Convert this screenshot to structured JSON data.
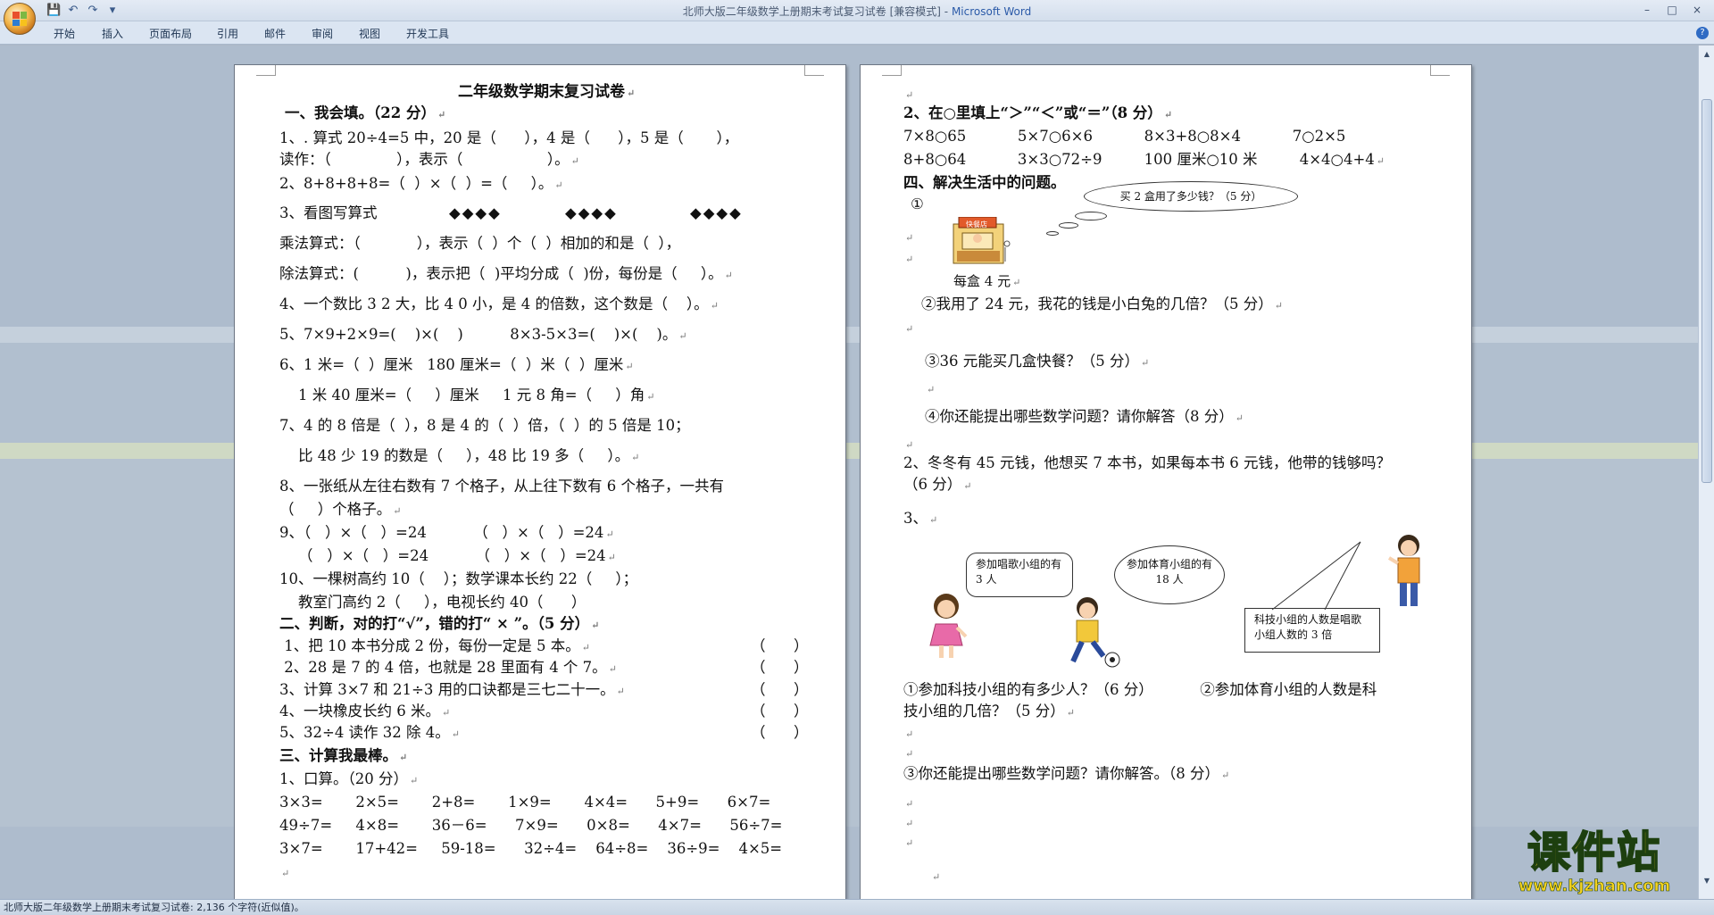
{
  "window": {
    "title_doc": "北师大版二年级数学上册期末考试复习试卷 [兼容模式]",
    "title_sep": " - ",
    "title_app": "Microsoft Word",
    "controls": [
      "–",
      "□",
      "×"
    ]
  },
  "quick_access": {
    "save": "💾",
    "undo": "↶",
    "redo": "↷",
    "more": "▾"
  },
  "ribbon": {
    "tabs": [
      "开始",
      "插入",
      "页面布局",
      "引用",
      "邮件",
      "审阅",
      "视图",
      "开发工具"
    ],
    "help": "?"
  },
  "status_bar": {
    "text": "北师大版二年级数学上册期末考试复习试卷: 2,136 个字符(近似值)。"
  },
  "watermark": {
    "brand": "课件站",
    "url": "www.kjzhan.com"
  },
  "page1": {
    "lines": [
      "二年级数学期末复习试卷",
      "一、我会填。（22 分）",
      "1、. 算式 20÷4=5 中，20 是（      ），4 是（      ），5 是（       ），",
      "读作：（              ），表示（                  ）。",
      "2、8+8+8+8=（  ）×（  ）=（     ）。",
      "3、看图写算式",
      "乘法算式：（            ），表示（  ）个（  ）相加的和是（  ），",
      "除法算式：(          )，表示把（  )平均分成（  )份，每份是（     ）。",
      "4、一个数比 3 2 大，比 4 0 小，是 4 的倍数，这个数是（    ）。",
      "5、7×9+2×9=(    )×(    )          8×3-5×3=(    )×(    )。",
      "6、1 米=（  ）厘米   180 厘米=（  ）米（  ）厘米",
      "    1 米 40 厘米=（     ）厘米     1 元 8 角=（     ）角",
      "7、4 的 8 倍是（  ），8 是 4 的（  ）倍，（  ）的 5 倍是 10；",
      "    比 48 少 19 的数是（     ），48 比 19 多（     ）。",
      "8、一张纸从左往右数有 7 个格子，从上往下数有 6 个格子，一共有",
      "（     ）个格子。",
      "9、（   ）×（   ）=24          （   ）×（   ）=24",
      "    （   ）×（   ）=24          （   ）×（   ）=24",
      "10、一棵树高约 10（    ）；数学课本长约 22（     ）；",
      "    教室门高约 2（     ），电视长约 40（      ）",
      "二、判断，对的打“√”，错的打“ × ”。（5 分）",
      " 1、把 10 本书分成 2 份，每份一定是 5 本。",
      " 2、28 是 7 的 4 倍，也就是 28 里面有 4 个 7。",
      "3、计算 3×7 和 21÷3 用的口诀都是三七二十一。",
      "4、一块橡皮长约 6 米。",
      "5、32÷4 读作 32 除 4。",
      "三、计算我最棒。",
      "1、口算。（20 分）",
      "3×3=       2×5=       2+8=       1×9=       4×4=      5+9=      6×7=",
      "49÷7=     4×8=       36－6=      7×9=      0×8=      4×7=      56÷7=",
      "3×7=       17+42=     59-18=      32÷4=    64÷8=    36÷9=    4×5="
    ],
    "diamonds": [
      "◆◆◆◆",
      "◆◆◆◆",
      "◆◆◆◆"
    ],
    "judge_brackets": [
      "（      ）",
      "（      ）",
      "（      ）",
      "（      ）",
      "（      ）"
    ]
  },
  "page2": {
    "lines": [
      "2、在○里填上“＞”“＜”或“＝”（8 分）",
      "7×8○65           5×7○6×6           8×3+8○8×4           7○2×5",
      "8+8○64           3×3○72÷9         100 厘米○10 米         4×4○4+4",
      "四、解决生活中的问题。",
      "①",
      "②我用了 24 元，我花的钱是小白兔的几倍？（5 分）",
      "③36 元能买几盒快餐？（5 分）",
      "④你还能提出哪些数学问题？请你解答（8 分）",
      "2、冬冬有 45 元钱，他想买 7 本书，如果每本书 6 元钱，他带的钱够吗？",
      "（6 分）",
      "3、",
      "①参加科技小组的有多少人？（6 分）          ②参加体育小组的人数是科",
      "技小组的几倍？（5 分）",
      "③你还能提出哪些数学问题？请你解答。（8 分）"
    ],
    "per_box_label": "每盒 4 元",
    "shop_sign": "快餐店",
    "thought_q": "买 2 盒用了多少钱？（5 分）",
    "bubble_sing": "参加唱歌小组的有 3 人",
    "bubble_sports": "参加体育小组的有 18 人",
    "bubble_tech": "科技小组的人数是唱歌小组人数的 3 倍"
  }
}
